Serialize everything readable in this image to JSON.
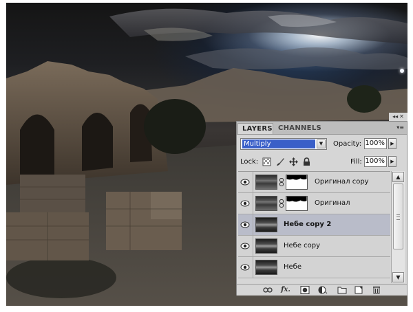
{
  "panel": {
    "tabs": [
      {
        "label": "LAYERS",
        "active": true
      },
      {
        "label": "CHANNELS",
        "active": false
      }
    ],
    "blend_mode": "Multiply",
    "opacity_label": "Opacity:",
    "opacity_value": "100%",
    "lock_label": "Lock:",
    "fill_label": "Fill:",
    "fill_value": "100%"
  },
  "layers": [
    {
      "name": "Оригинал copy",
      "thumb": "photo",
      "has_mask": true,
      "selected": false,
      "visible": true
    },
    {
      "name": "Оригинал",
      "thumb": "photo",
      "has_mask": true,
      "selected": false,
      "visible": true
    },
    {
      "name": "Небе copy 2",
      "thumb": "sky",
      "has_mask": false,
      "selected": true,
      "visible": true
    },
    {
      "name": "Небе copy",
      "thumb": "sky",
      "has_mask": false,
      "selected": false,
      "visible": true
    },
    {
      "name": "Небе",
      "thumb": "sky",
      "has_mask": false,
      "selected": false,
      "visible": true
    }
  ],
  "colors": {
    "panel_bg": "#d6d6d6",
    "selected_row": "#b9bcc9",
    "blend_highlight": "#3a5fc8"
  },
  "bottom_icons": [
    "link-icon",
    "fx-icon",
    "mask-icon",
    "adjustment-icon",
    "folder-icon",
    "new-layer-icon",
    "trash-icon"
  ]
}
